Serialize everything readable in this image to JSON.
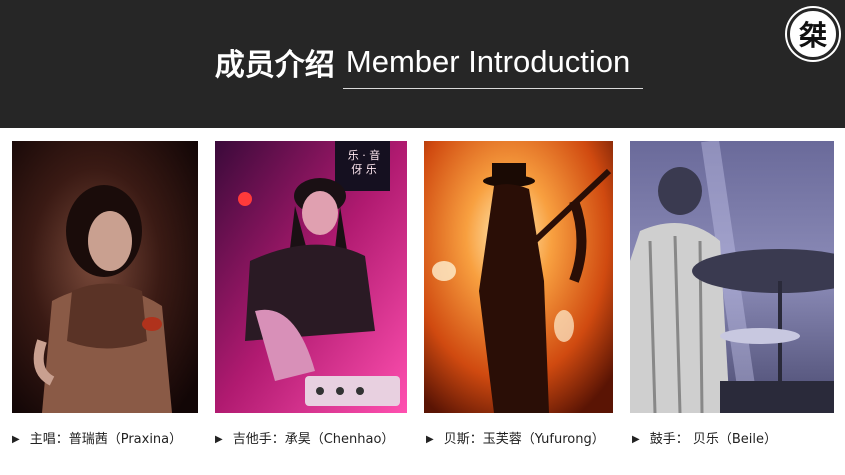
{
  "header": {
    "title_cn": "成员介绍",
    "title_en": "Member Introduction",
    "logo_text": "桀"
  },
  "members": [
    {
      "label": "主唱：普瑞茜（Praxina）"
    },
    {
      "label": "吉他手：承昊（Chenhao）"
    },
    {
      "label": "贝斯：玉芙蓉（Yufurong）"
    },
    {
      "label": "鼓手： 贝乐（Beile）"
    }
  ],
  "signs": {
    "sign_left": "乐 · 音",
    "sign_right": "伢 乐"
  },
  "colors": {
    "header_bg": "#262626",
    "photo1": "#3a1a14",
    "photo2": "#c0207a",
    "photo3": "#f08a30",
    "photo4": "#7c7ca6"
  }
}
